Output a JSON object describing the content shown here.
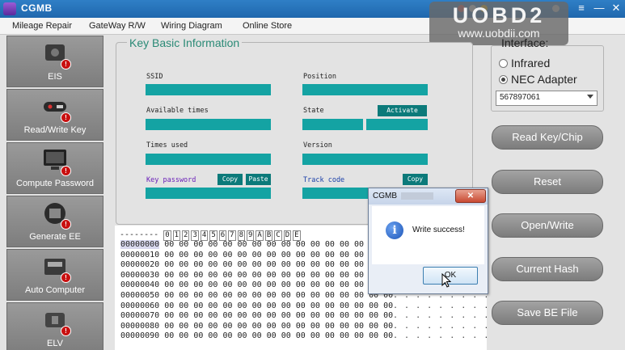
{
  "window": {
    "title": "CGMB",
    "controls": {
      "menu": "≡",
      "minimize": "—",
      "close": "✕"
    }
  },
  "watermark": {
    "brand": "UOBD2",
    "url": "www.uobdii.com"
  },
  "menu": [
    "Mileage Repair",
    "GateWay R/W",
    "Wiring Diagram",
    "Online Store"
  ],
  "sidebar": {
    "items": [
      {
        "label": "EIS",
        "icon": "eis-module-icon"
      },
      {
        "label": "Read/Write Key",
        "icon": "car-key-icon"
      },
      {
        "label": "Compute Password",
        "icon": "computer-icon"
      },
      {
        "label": "Generate EE",
        "icon": "chip-programmer-icon"
      },
      {
        "label": "Auto Computer",
        "icon": "ecu-icon"
      },
      {
        "label": "ELV",
        "icon": "steering-lock-icon"
      }
    ],
    "badge": "!"
  },
  "key_info": {
    "title": "Key Basic Information",
    "ssid_label": "SSID",
    "position_label": "Position",
    "available_times_label": "Available times",
    "state_label": "State",
    "activate_button": "Activate",
    "times_used_label": "Times used",
    "version_label": "Version",
    "key_password_label": "Key password",
    "copy_button": "Copy",
    "paste_button": "Paste",
    "track_code_label": "Track code",
    "copy_button_2": "Copy"
  },
  "hex": {
    "header_prefix": "--------",
    "columns": [
      "0",
      "1",
      "2",
      "3",
      "4",
      "5",
      "6",
      "7",
      "8",
      "9",
      "A",
      "B",
      "C",
      "D",
      "E"
    ],
    "rows": [
      {
        "addr": "00000000",
        "bytes": "00 00 00 00 00 00 00 00 00 00 00 00 00 00 00 00",
        "ascii": ". . . . . . . . . . . ."
      },
      {
        "addr": "00000010",
        "bytes": "00 00 00 00 00 00 00 00 00 00 00 00 00 00 00 00",
        "ascii": ". . . . . . . . . . . ."
      },
      {
        "addr": "00000020",
        "bytes": "00 00 00 00 00 00 00 00 00 00 00 00 00 00 00 00",
        "ascii": ". . . . . . . . . . . ."
      },
      {
        "addr": "00000030",
        "bytes": "00 00 00 00 00 00 00 00 00 00 00 00 00 00 00 00",
        "ascii": ". . . . . . . . . . . ."
      },
      {
        "addr": "00000040",
        "bytes": "00 00 00 00 00 00 00 00 00 00 00 00 00 00 00 00",
        "ascii": ". . . . . . . . . . . ."
      },
      {
        "addr": "00000050",
        "bytes": "00 00 00 00 00 00 00 00 00 00 00 00 00 00 00 00",
        "ascii": ". . . . . . . . . . . ."
      },
      {
        "addr": "00000060",
        "bytes": "00 00 00 00 00 00 00 00 00 00 00 00 00 00 00 00",
        "ascii": ". . . . . . . . . . . ."
      },
      {
        "addr": "00000070",
        "bytes": "00 00 00 00 00 00 00 00 00 00 00 00 00 00 00 00",
        "ascii": ". . . . . . . . . . . ."
      },
      {
        "addr": "00000080",
        "bytes": "00 00 00 00 00 00 00 00 00 00 00 00 00 00 00 00",
        "ascii": ". . . . . . . . . . . ."
      },
      {
        "addr": "00000090",
        "bytes": "00 00 00 00 00 00 00 00 00 00 00 00 00 00 00 00",
        "ascii": ". . . . . . . . . . . ."
      }
    ]
  },
  "interface": {
    "title": "Interface:",
    "options": [
      "Infrared",
      "NEC Adapter"
    ],
    "selected": "NEC Adapter",
    "port_value": "567897061"
  },
  "actions": [
    "Read Key/Chip",
    "Reset",
    "Open/Write",
    "Current Hash",
    "Save BE File"
  ],
  "dialog": {
    "title": "CGMB",
    "close": "✕",
    "icon": "i",
    "message": "Write success!",
    "ok": "OK"
  },
  "colors": {
    "titlebar": "#2f7fc6",
    "field": "#14a3a3",
    "field_button": "#0c7a7a",
    "accent_text": "#2a8a76",
    "key_password_label": "#6a1fb8",
    "track_code_label": "#1a3fa8"
  }
}
